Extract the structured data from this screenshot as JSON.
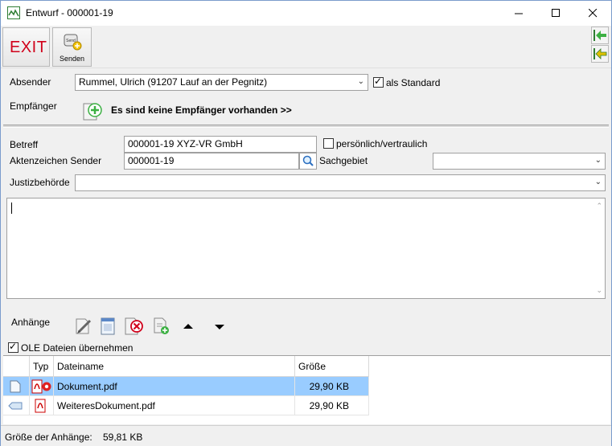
{
  "window": {
    "title": "Entwurf - 000001-19",
    "controls": {
      "minimize": "—",
      "maximize": "☐",
      "close": "✕"
    }
  },
  "toolbar": {
    "exit_label": "EXIT",
    "send_label": "Senden",
    "send_icon_text": "Send"
  },
  "form": {
    "absender_label": "Absender",
    "absender_value": "Rummel, Ulrich (91207 Lauf an der Pegnitz)",
    "als_standard_label": "als Standard",
    "als_standard_checked": true,
    "empfaenger_label": "Empfänger",
    "empfaenger_link": "Es sind keine Empfänger vorhanden >>",
    "betreff_label": "Betreff",
    "betreff_value": "000001-19 XYZ-VR GmbH",
    "vertraulich_label": "persönlich/vertraulich",
    "vertraulich_checked": false,
    "aktenzeichen_label": "Aktenzeichen Sender",
    "aktenzeichen_value": "000001-19",
    "sachgebiet_label": "Sachgebiet",
    "sachgebiet_value": "",
    "justiz_label": "Justizbehörde",
    "justiz_value": "",
    "message_text": ""
  },
  "attachments": {
    "label": "Anhänge",
    "ole_label": "OLE Dateien übernehmen",
    "ole_checked": true,
    "columns": {
      "type": "Typ",
      "name": "Dateiname",
      "size": "Größe"
    },
    "rows": [
      {
        "name": "Dokument.pdf",
        "size": "29,90 KB",
        "selected": true
      },
      {
        "name": "WeiteresDokument.pdf",
        "size": "29,90 KB",
        "selected": false
      }
    ]
  },
  "status": {
    "label": "Größe der Anhänge:",
    "value": "59,81 KB"
  },
  "colors": {
    "exit_red": "#d0021b",
    "selection": "#99ccff",
    "add_green": "#3cb043",
    "delete_red": "#d0021b",
    "pdf_red": "#cc0000"
  }
}
